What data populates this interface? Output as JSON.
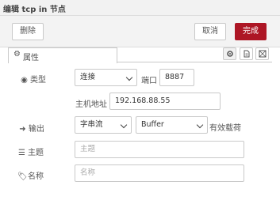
{
  "window": {
    "title": "编辑 tcp in 节点"
  },
  "toolbar": {
    "delete_label": "删除",
    "cancel_label": "取消",
    "done_label": "完成"
  },
  "tabs": [
    {
      "label": "属性"
    }
  ],
  "form": {
    "type": {
      "label": "类型",
      "value": "连接"
    },
    "port": {
      "label": "端口",
      "value": "8887"
    },
    "host": {
      "label": "主机地址",
      "value": "192.168.88.55"
    },
    "output": {
      "label": "输出",
      "value": "字串流",
      "format": "Buffer",
      "suffix": "有效载荷"
    },
    "topic": {
      "label": "主题",
      "placeholder": "主题"
    },
    "name": {
      "label": "名称",
      "placeholder": "名称"
    }
  },
  "colors": {
    "accent": "#ad1625",
    "border": "#c9c9c9",
    "background": "#f5f5f5"
  },
  "icons": [
    "gear-icon",
    "radio-dot-icon",
    "sign-in-icon",
    "list-icon",
    "tag-icon",
    "settings-icon",
    "document-icon",
    "frame-icon"
  ]
}
